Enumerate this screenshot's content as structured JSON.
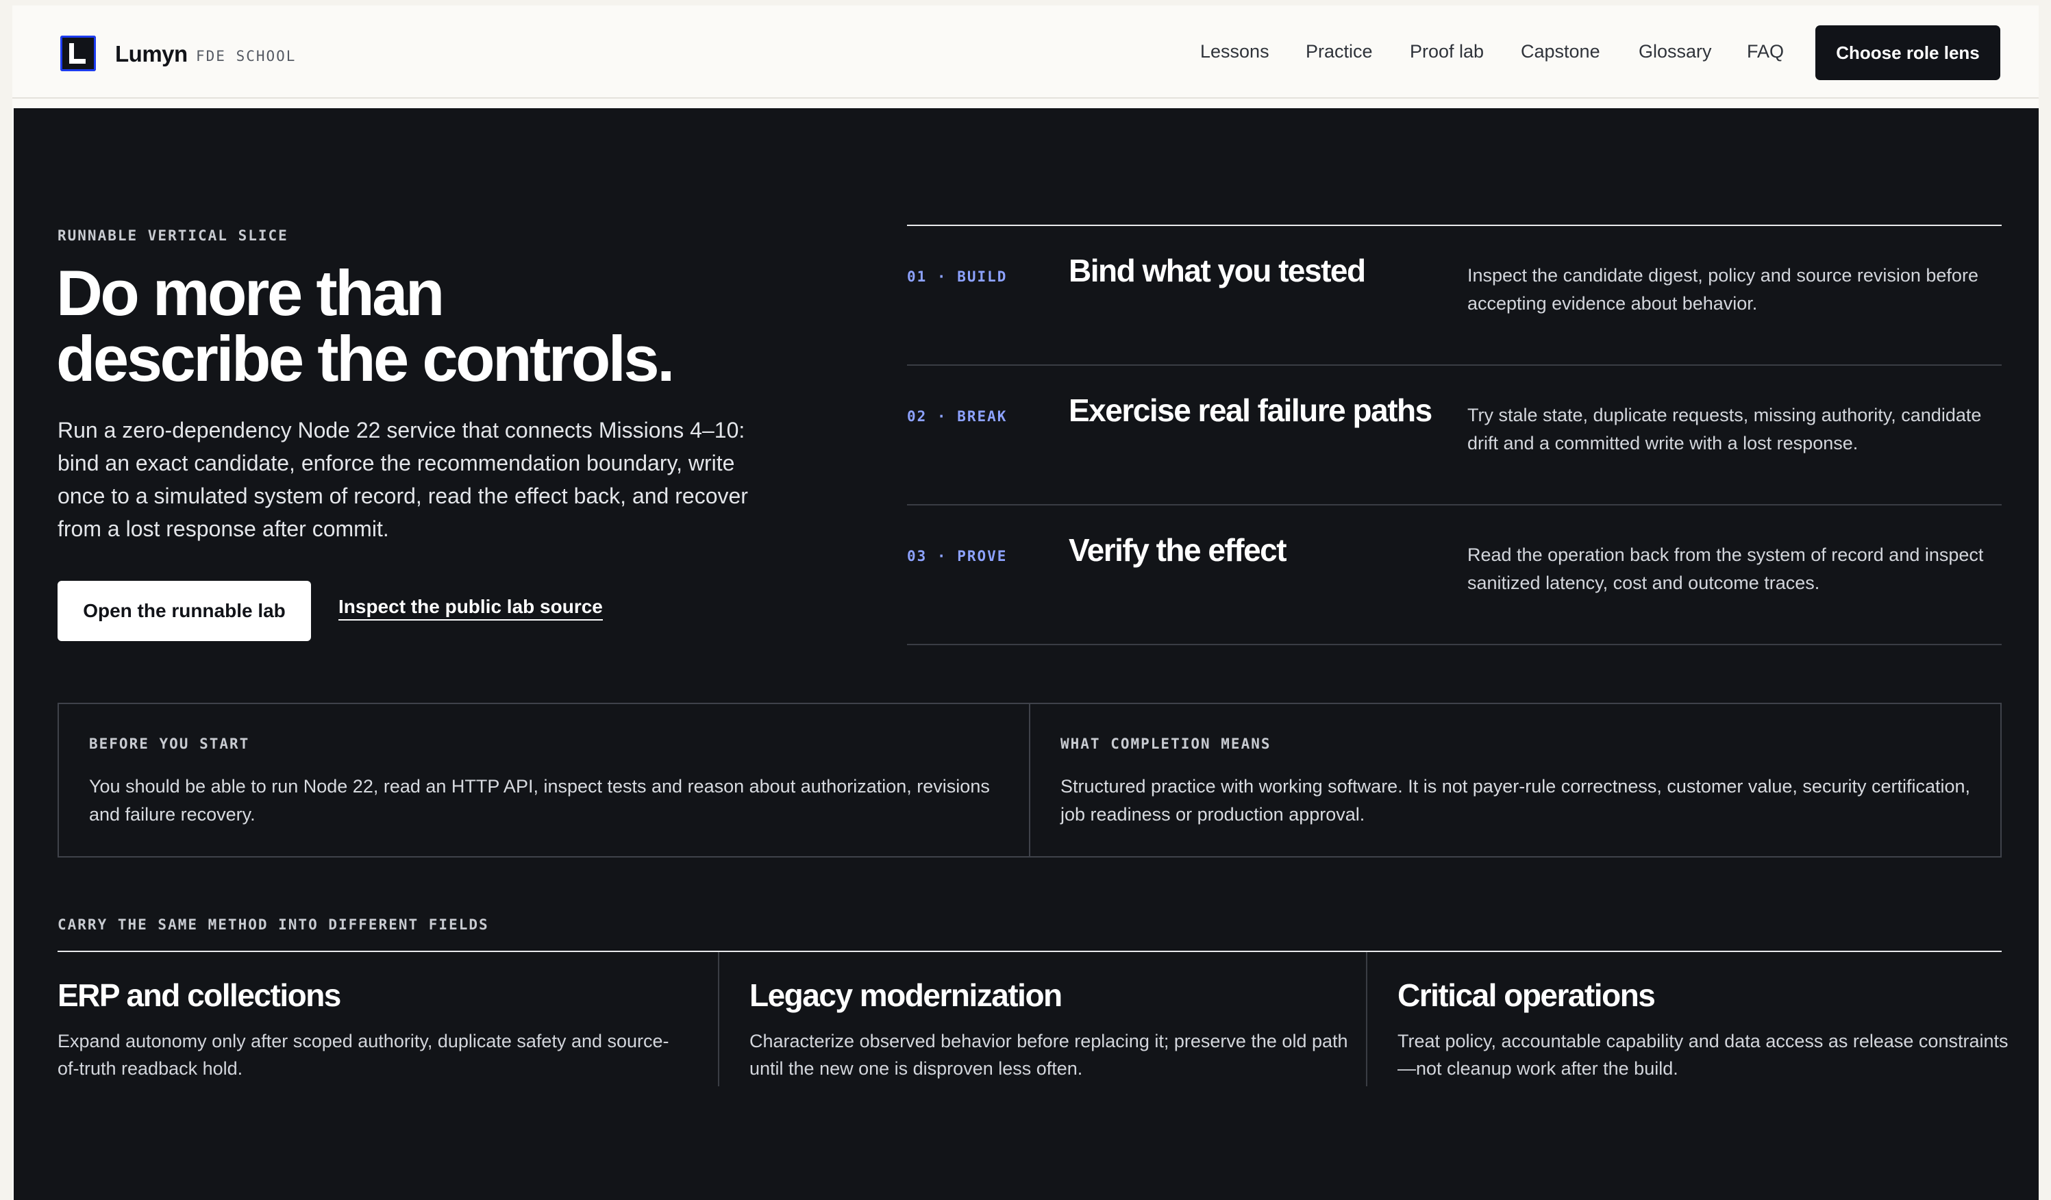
{
  "brand": {
    "name": "Lumyn",
    "sub": "FDE SCHOOL",
    "logo_icon": "lumyn-logo-icon"
  },
  "nav": {
    "items": [
      "Lessons",
      "Practice",
      "Proof lab",
      "Capstone",
      "Glossary",
      "FAQ"
    ],
    "cta": "Choose role lens"
  },
  "hero": {
    "eyebrow": "RUNNABLE VERTICAL SLICE",
    "title_line1": "Do more than",
    "title_line2": "describe the controls.",
    "description": "Run a zero-dependency Node 22 service that connects Missions 4–10: bind an exact candidate, enforce the recommendation boundary, write once to a simulated system of record, read the effect back, and recover from a lost response after commit.",
    "primary_button": "Open the runnable lab",
    "secondary_link": "Inspect the public lab source"
  },
  "steps": [
    {
      "num": "01 · BUILD",
      "title": "Bind what you tested",
      "desc": "Inspect the candidate digest, policy and source revision before accepting evidence about behavior."
    },
    {
      "num": "02 · BREAK",
      "title": "Exercise real failure paths",
      "desc": "Try stale state, duplicate requests, missing authority, candidate drift and a committed write with a lost response."
    },
    {
      "num": "03 · PROVE",
      "title": "Verify the effect",
      "desc": "Read the operation back from the system of record and inspect sanitized latency, cost and outcome traces."
    }
  ],
  "info": {
    "before_head": "BEFORE YOU START",
    "before_text": "You should be able to run Node 22, read an HTTP API, inspect tests and reason about authorization, revisions and failure recovery.",
    "completion_head": "WHAT COMPLETION MEANS",
    "completion_text": "Structured practice with working software. It is not payer-rule correctness, customer value, security certification, job readiness or production approval."
  },
  "fields": {
    "label": "CARRY THE SAME METHOD INTO DIFFERENT FIELDS",
    "items": [
      {
        "title": "ERP and collections",
        "desc": "Expand autonomy only after scoped authority, duplicate safety and source-of-truth readback hold."
      },
      {
        "title": "Legacy modernization",
        "desc": "Characterize observed behavior before replacing it; preserve the old path until the new one is disproven less often."
      },
      {
        "title": "Critical operations",
        "desc": "Treat policy, accountable capability and data access as release constraints—not cleanup work after the build."
      }
    ]
  },
  "colors": {
    "dark_bg": "#121418",
    "accent": "#8da2ff",
    "header_bg": "#fbfaf7"
  }
}
